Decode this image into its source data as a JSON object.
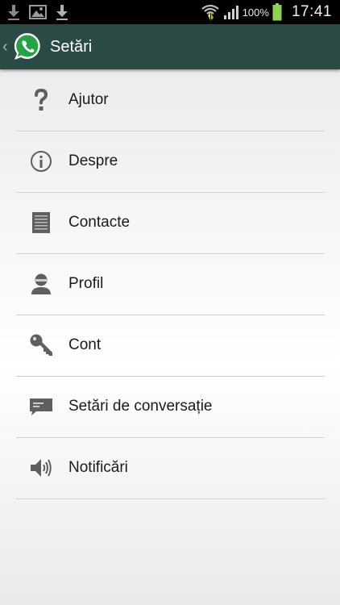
{
  "status_bar": {
    "battery_percent": "100%",
    "time": "17:41",
    "notification_icons": [
      "download-icon",
      "image-icon",
      "download-icon"
    ]
  },
  "action_bar": {
    "title": "Setări",
    "background": "#2c4a45",
    "logo_color": "#25a244"
  },
  "settings": {
    "items": [
      {
        "label": "Ajutor",
        "icon": "help-icon"
      },
      {
        "label": "Despre",
        "icon": "info-icon"
      },
      {
        "label": "Contacte",
        "icon": "contacts-icon"
      },
      {
        "label": "Profil",
        "icon": "profile-icon"
      },
      {
        "label": "Cont",
        "icon": "key-icon"
      },
      {
        "label": "Setări de conversație",
        "icon": "chat-icon"
      },
      {
        "label": "Notificări",
        "icon": "speaker-icon"
      }
    ]
  }
}
